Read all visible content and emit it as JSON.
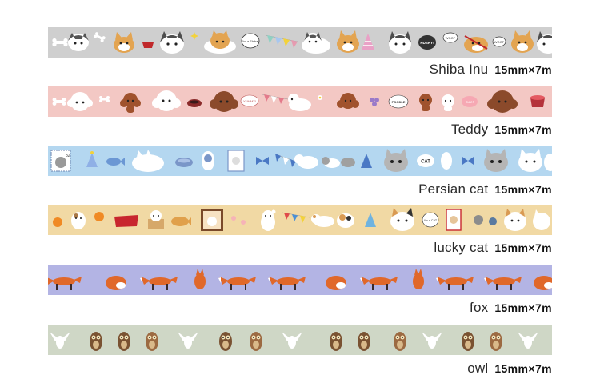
{
  "products": [
    {
      "name": "Shiba Inu",
      "size": "15mm×7m",
      "color": "#cfcfcf",
      "theme": "dogs",
      "bubbles": [
        "I'm a Shiba!",
        "HUSKY!",
        "WOOF",
        "WOOF"
      ]
    },
    {
      "name": "Teddy",
      "size": "15mm×7m",
      "color": "#f3c8c4",
      "theme": "poodles",
      "bubbles": [
        "YUMMY!",
        "POODLE",
        "cute!"
      ]
    },
    {
      "name": "Persian cat",
      "size": "15mm×7m",
      "color": "#b4d7f0",
      "theme": "cats",
      "bubbles": [
        "CAT",
        "82"
      ]
    },
    {
      "name": "lucky cat",
      "size": "15mm×7m",
      "color": "#f1d9a4",
      "theme": "lucky",
      "bubbles": [
        "I'm a CAT"
      ]
    },
    {
      "name": "fox",
      "size": "15mm×7m",
      "color": "#b3b4e4",
      "theme": "fox",
      "bubbles": []
    },
    {
      "name": "owl",
      "size": "15mm×7m",
      "color": "#cfd7c6",
      "theme": "owl",
      "bubbles": []
    }
  ]
}
